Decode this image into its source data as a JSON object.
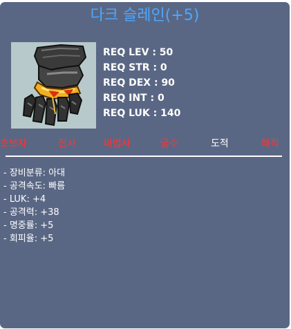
{
  "item": {
    "title": "다크 슬레인(+5)",
    "icon": "dark-slain-glove-icon"
  },
  "requirements": [
    {
      "label": "REQ LEV : 50"
    },
    {
      "label": "REQ STR : 0"
    },
    {
      "label": "REQ DEX : 90"
    },
    {
      "label": "REQ INT : 0"
    },
    {
      "label": "REQ LUK : 140"
    }
  ],
  "jobs": [
    {
      "name": "초보자",
      "color": "#ff3333"
    },
    {
      "name": "전사",
      "color": "#ff3333"
    },
    {
      "name": "마법사",
      "color": "#ff3333"
    },
    {
      "name": "궁수",
      "color": "#ff3333"
    },
    {
      "name": "도적",
      "color": "#ffffff"
    },
    {
      "name": "해적",
      "color": "#ff3333"
    }
  ],
  "details": [
    "- 장비분류: 아대",
    "- 공격속도: 빠름",
    "- LUK: +4",
    "- 공격력: +38",
    "- 명중률: +5",
    "- 회피율: +5"
  ],
  "colors": {
    "panel_bg": "#5a6784",
    "title": "#4da8ff",
    "unavailable_job": "#ff3333",
    "available_job": "#ffffff"
  }
}
